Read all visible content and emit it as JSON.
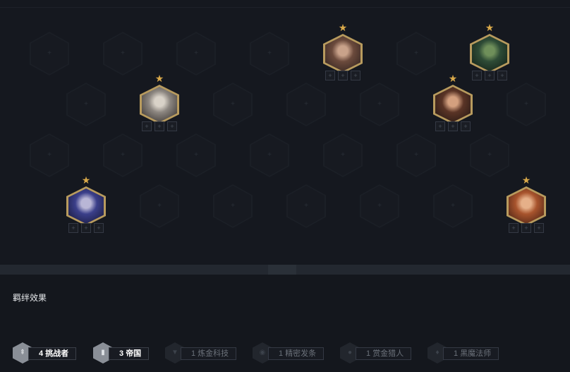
{
  "board": {
    "empty_slot_glyph": "+",
    "item_slot_glyph": "+",
    "star_glyph": "★",
    "units": [
      {
        "name": "unit-bald-brawler",
        "row": 0,
        "col": 4,
        "stars": 1,
        "colors": [
          "#6b4a3c",
          "#2a1f1c",
          "#c9a28a"
        ]
      },
      {
        "name": "unit-green-monster",
        "row": 0,
        "col": 6,
        "stars": 1,
        "colors": [
          "#2e4b36",
          "#0f1a13",
          "#6f8f5a"
        ]
      },
      {
        "name": "unit-white-haired-knight",
        "row": 1,
        "col": 1,
        "stars": 1,
        "colors": [
          "#8c8680",
          "#2b2623",
          "#d9d2c8"
        ]
      },
      {
        "name": "unit-dark-haired-woman",
        "row": 1,
        "col": 5,
        "stars": 1,
        "colors": [
          "#5a3426",
          "#1f1512",
          "#d4a07f"
        ]
      },
      {
        "name": "unit-hooded-assassin",
        "row": 3,
        "col": 0,
        "stars": 1,
        "colors": [
          "#3b3f8a",
          "#121330",
          "#b9b6d6"
        ]
      },
      {
        "name": "unit-red-haired-gunner",
        "row": 3,
        "col": 6,
        "stars": 1,
        "colors": [
          "#a8542d",
          "#3a1a10",
          "#e6b089"
        ]
      }
    ]
  },
  "synergy": {
    "title": "羁绊效果",
    "traits": [
      {
        "name": "trait-challenger",
        "count": "4",
        "label": "挑战者",
        "active": true,
        "icon": "sword-icon",
        "glyph": "⇞"
      },
      {
        "name": "trait-empire",
        "count": "3",
        "label": "帝国",
        "active": true,
        "icon": "banner-icon",
        "glyph": "▮"
      },
      {
        "name": "trait-hextech",
        "count": "1",
        "label": "炼金科技",
        "active": false,
        "icon": "chevron-icon",
        "glyph": "▼"
      },
      {
        "name": "trait-cryptic",
        "count": "1",
        "label": "精密发条",
        "active": false,
        "icon": "gear-icon",
        "glyph": "◉"
      },
      {
        "name": "trait-bounty",
        "count": "1",
        "label": "赏金猎人",
        "active": false,
        "icon": "coin-icon",
        "glyph": "●"
      },
      {
        "name": "trait-warlock",
        "count": "1",
        "label": "黑魔法师",
        "active": false,
        "icon": "flame-icon",
        "glyph": "♦"
      }
    ]
  }
}
